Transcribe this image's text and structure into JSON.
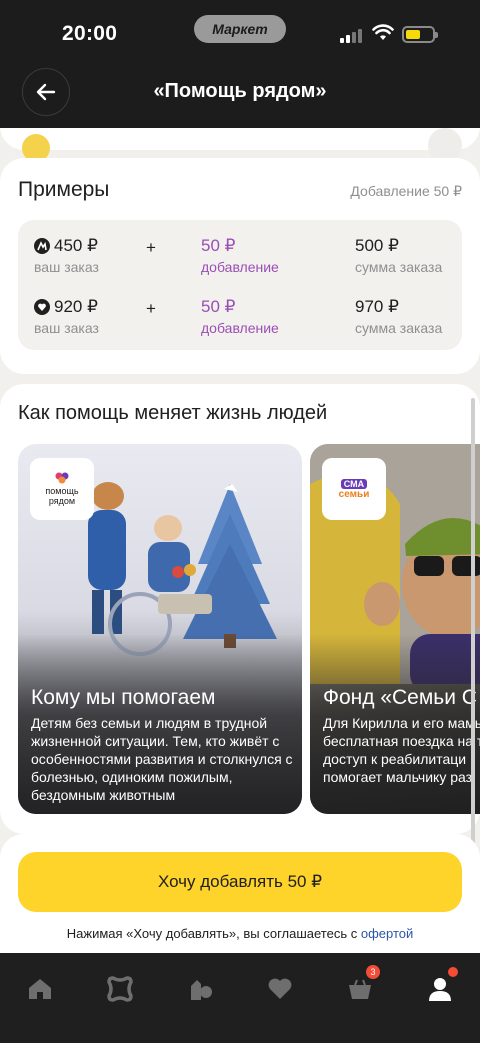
{
  "status_bar": {
    "time": "20:00",
    "app_label": "Маркет",
    "battery_level": 0.55,
    "battery_color": "#f5d90a"
  },
  "header": {
    "title": "«Помощь рядом»",
    "back_icon": "arrow-left-icon"
  },
  "examples": {
    "title": "Примеры",
    "note": "Добавление 50 ₽",
    "rows": [
      {
        "shop_icon": "market-logo-icon",
        "order_value": "450 ₽",
        "order_label": "ваш заказ",
        "plus": "+",
        "add_value": "50 ₽",
        "add_label": "добавление",
        "total_value": "500 ₽",
        "total_label": "сумма заказа"
      },
      {
        "shop_icon": "heart-logo-icon",
        "order_value": "920 ₽",
        "order_label": "ваш заказ",
        "plus": "+",
        "add_value": "50 ₽",
        "add_label": "добавление",
        "total_value": "970 ₽",
        "total_label": "сумма заказа"
      }
    ]
  },
  "help_section": {
    "title": "Как помощь меняет жизнь людей",
    "slides": [
      {
        "logo_text": "помощь рядом",
        "title": "Кому мы помогаем",
        "text": "Детям без семьи и людям в трудной жизненной ситуации. Тем, кто живёт с особенностями развития и столкнулся с болезнью, одиноким пожилым, бездомным животным"
      },
      {
        "logo_text_top": "СМА",
        "logo_text_bottom": "семьи",
        "title": "Фонд «Семьи С",
        "text_lines": [
          "Для Кирилла и его мамы",
          "бесплатная поездка на т",
          "доступ к реабилитаци",
          "помогает мальчику раз"
        ]
      }
    ]
  },
  "cta": {
    "button_label": "Хочу добавлять 50 ₽",
    "note_prefix": "Нажимая «Хочу добавлять», вы соглашаетесь с ",
    "note_link": "офертой"
  },
  "bottom_nav": {
    "items": [
      {
        "icon": "home-icon"
      },
      {
        "icon": "catalog-icon"
      },
      {
        "icon": "products-icon"
      },
      {
        "icon": "heart-icon"
      },
      {
        "icon": "cart-icon",
        "badge": "3"
      },
      {
        "icon": "profile-icon"
      }
    ]
  },
  "colors": {
    "accent_yellow": "#fed42b",
    "purple": "#9a4fb5",
    "link_blue": "#2c55a8",
    "badge_red": "#f44c36"
  }
}
